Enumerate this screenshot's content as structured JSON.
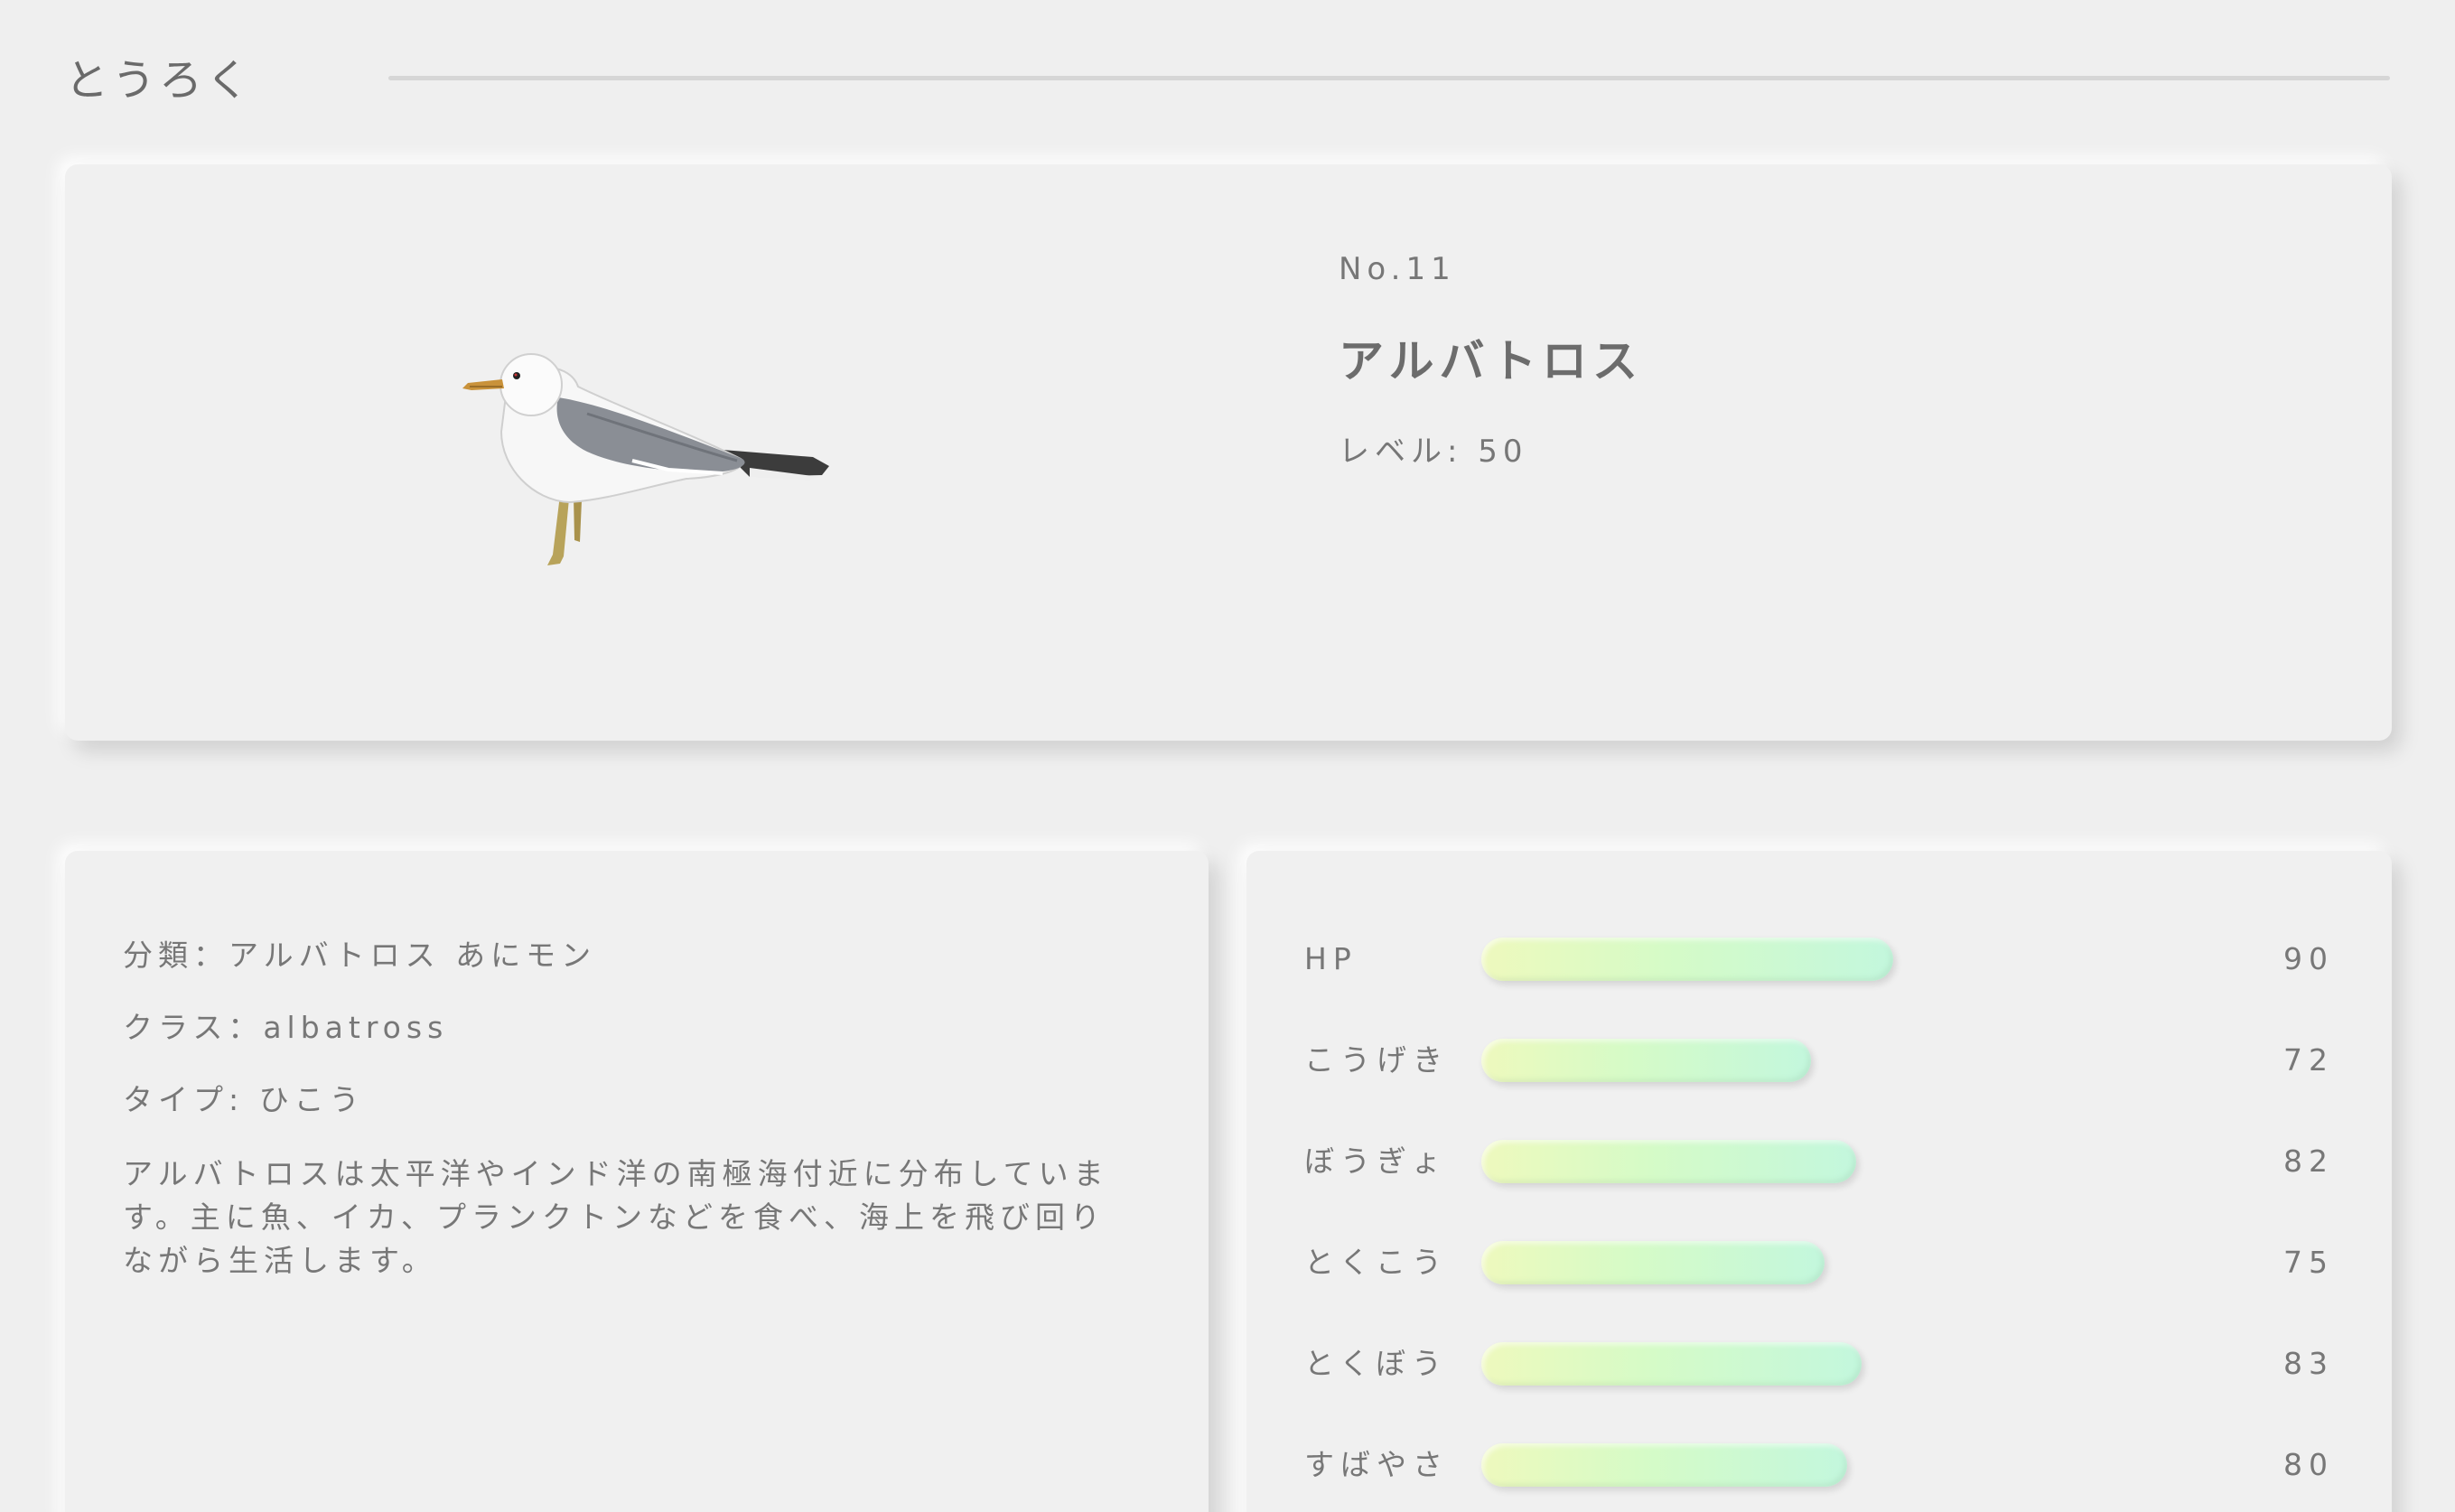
{
  "header": {
    "title": "とうろく"
  },
  "profile": {
    "number": "No.11",
    "name": "アルバトロス",
    "level": "レベル: 50",
    "image_alt": "albatross-image"
  },
  "info": {
    "classification": "分類：アルバトロス あにモン",
    "class": "クラス：albatross",
    "type": "タイプ: ひこう",
    "description": "アルバトロスは太平洋やインド洋の南極海付近に分布しています。主に魚、イカ、プランクトンなどを食べ、海上を飛び回りながら生活します。"
  },
  "stats": {
    "max": 150,
    "items": [
      {
        "label": "HP",
        "value": 90
      },
      {
        "label": "こうげき",
        "value": 72
      },
      {
        "label": "ぼうぎょ",
        "value": 82
      },
      {
        "label": "とくこう",
        "value": 75
      },
      {
        "label": "とくぼう",
        "value": 83
      },
      {
        "label": "すばやさ",
        "value": 80
      }
    ]
  },
  "colors": {
    "background": "#efefef",
    "bar_start": "#eef9bd",
    "bar_end": "#c3f7dd"
  }
}
